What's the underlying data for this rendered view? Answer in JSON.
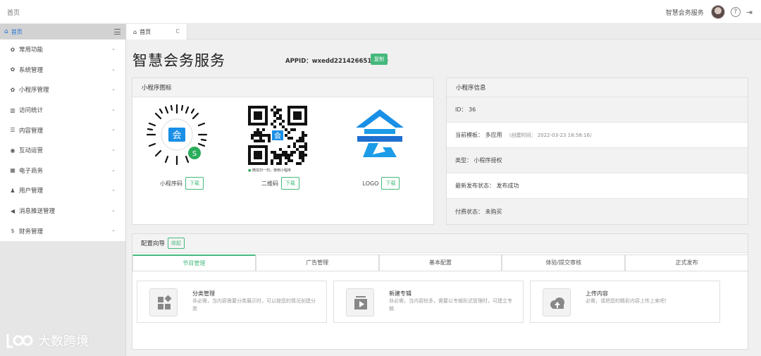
{
  "topbar": {
    "breadcrumb": "首页",
    "service_name": "智慧会务服务",
    "help": "?",
    "logout": "⇥"
  },
  "sidebar": {
    "home_label": "首页",
    "items": [
      {
        "label": "常用功能",
        "icon": "gear-icon",
        "glyph": "✿"
      },
      {
        "label": "系统管理",
        "icon": "gear-icon",
        "glyph": "✿"
      },
      {
        "label": "小程序管理",
        "icon": "gear-icon",
        "glyph": "✿"
      },
      {
        "label": "访问统计",
        "icon": "bar-chart-icon",
        "glyph": "▥"
      },
      {
        "label": "内容管理",
        "icon": "database-icon",
        "glyph": "☰"
      },
      {
        "label": "互动运营",
        "icon": "eye-icon",
        "glyph": "◉"
      },
      {
        "label": "电子商务",
        "icon": "calculator-icon",
        "glyph": "▦"
      },
      {
        "label": "用户管理",
        "icon": "users-icon",
        "glyph": "♟"
      },
      {
        "label": "消息推送管理",
        "icon": "volume-icon",
        "glyph": "◀"
      },
      {
        "label": "财务管理",
        "icon": "dollar-icon",
        "glyph": "$"
      }
    ]
  },
  "tab": {
    "label": "首页",
    "refresh": "C"
  },
  "page": {
    "title": "智慧会务服务",
    "appid": "APPID：wxedd2214266514369",
    "copy_label": "复制"
  },
  "mini_icons": {
    "header": "小程序图标",
    "items": [
      {
        "label": "小程序码",
        "download": "下载"
      },
      {
        "label": "二维码",
        "download": "下载"
      },
      {
        "label": "LOGO",
        "download": "下载"
      }
    ],
    "qr_caption": "微信扫一扫，使用小程序",
    "logo_char": "会"
  },
  "mini_info": {
    "header": "小程序信息",
    "rows": [
      {
        "text": "ID： 36",
        "sub": ""
      },
      {
        "text": "当前模板： 多应用",
        "sub": "（创建时间： 2022-03-23 18:58:16）"
      },
      {
        "text": "类型： 小程序授权",
        "sub": ""
      },
      {
        "text": "最新发布状态： 发布成功",
        "sub": ""
      },
      {
        "text": "付费状态： 未购买",
        "sub": ""
      }
    ]
  },
  "guide": {
    "header": "配置向导",
    "collapse": "收起",
    "tabs": [
      "节目管理",
      "广告管理",
      "基本配置",
      "体验/提交审核",
      "正式发布"
    ],
    "cards": [
      {
        "title": "分类管理",
        "desc": "非必需，当内容需要分类展示时，可以按您的情况创建分类"
      },
      {
        "title": "新建专辑",
        "desc": "非必需，当内容较多，需要以专辑形式管理时，可建立专辑"
      },
      {
        "title": "上传内容",
        "desc": "必需，请把您的精彩内容上传上来吧！"
      }
    ]
  },
  "watermark": "大数跨境",
  "colors": {
    "accent": "#45b97c",
    "link": "#1e6fd0",
    "logo_blue": "#1a8fe6"
  }
}
